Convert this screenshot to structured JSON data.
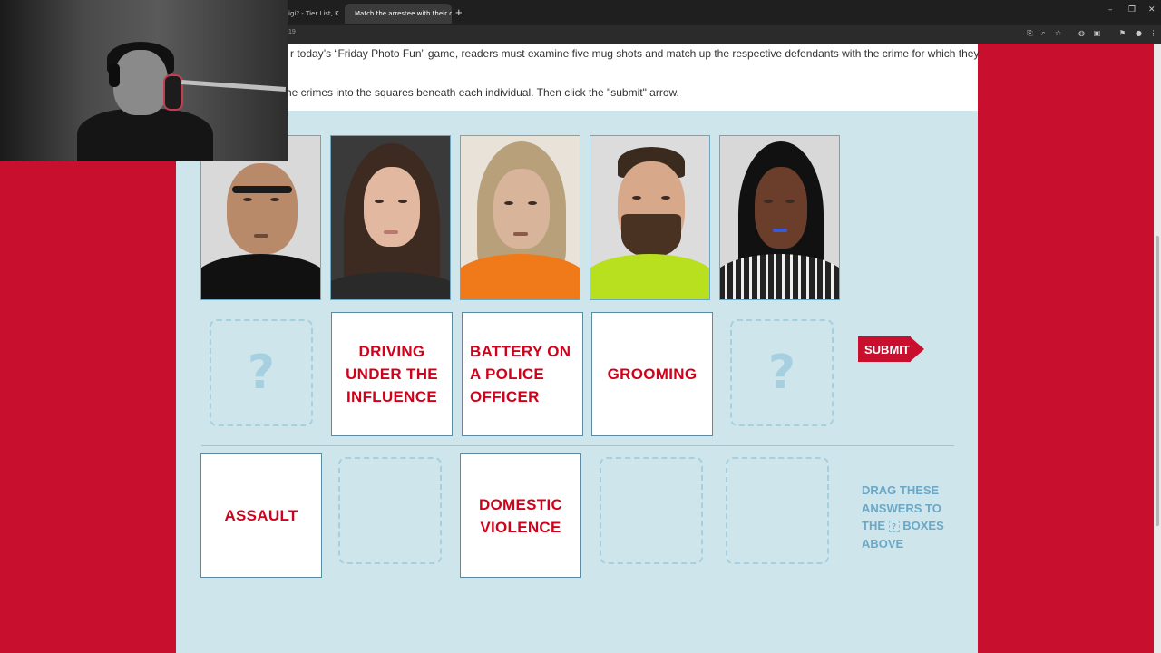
{
  "browser": {
    "tabs": [
      {
        "label": "igi? - Tier List, K",
        "active": false
      },
      {
        "label": "Match the arrestee with their c",
        "active": true
      }
    ],
    "new_tab": "+",
    "window_controls": {
      "minimize": "–",
      "restore": "❐",
      "close": "✕"
    },
    "address_partial": "19"
  },
  "intro": {
    "line1": "r today’s “Friday Photo Fun” game, readers must examine five mug shots and match up the respective defendants with the crime for which they",
    "line2": "he crimes into the squares beneath each individual. Then click the \"submit\" arrow."
  },
  "game": {
    "placed_answers": [
      {
        "slot": 1,
        "text": null,
        "placeholder": "?"
      },
      {
        "slot": 2,
        "text": "DRIVING UNDER THE INFLUENCE"
      },
      {
        "slot": 3,
        "text": "BATTERY ON A POLICE OFFICER"
      },
      {
        "slot": 4,
        "text": "GROOMING"
      },
      {
        "slot": 5,
        "text": null,
        "placeholder": "?"
      }
    ],
    "answer_bank": [
      {
        "text": "ASSAULT"
      },
      {
        "text": null
      },
      {
        "text": "DOMESTIC VIOLENCE"
      },
      {
        "text": null
      },
      {
        "text": null
      }
    ],
    "submit_label": "SUBMIT",
    "drag_hint": {
      "line1": "DRAG THESE",
      "line2": "ANSWERS TO",
      "line3a": "THE",
      "line3_icon": "?",
      "line3b": "BOXES",
      "line4": "ABOVE"
    }
  },
  "colors": {
    "brand_red": "#c8102e",
    "game_bg": "#cfe5ec",
    "slot_dash": "#a6cfdf",
    "answer_text": "#d0021b",
    "hint_text": "#6ba8c6"
  }
}
